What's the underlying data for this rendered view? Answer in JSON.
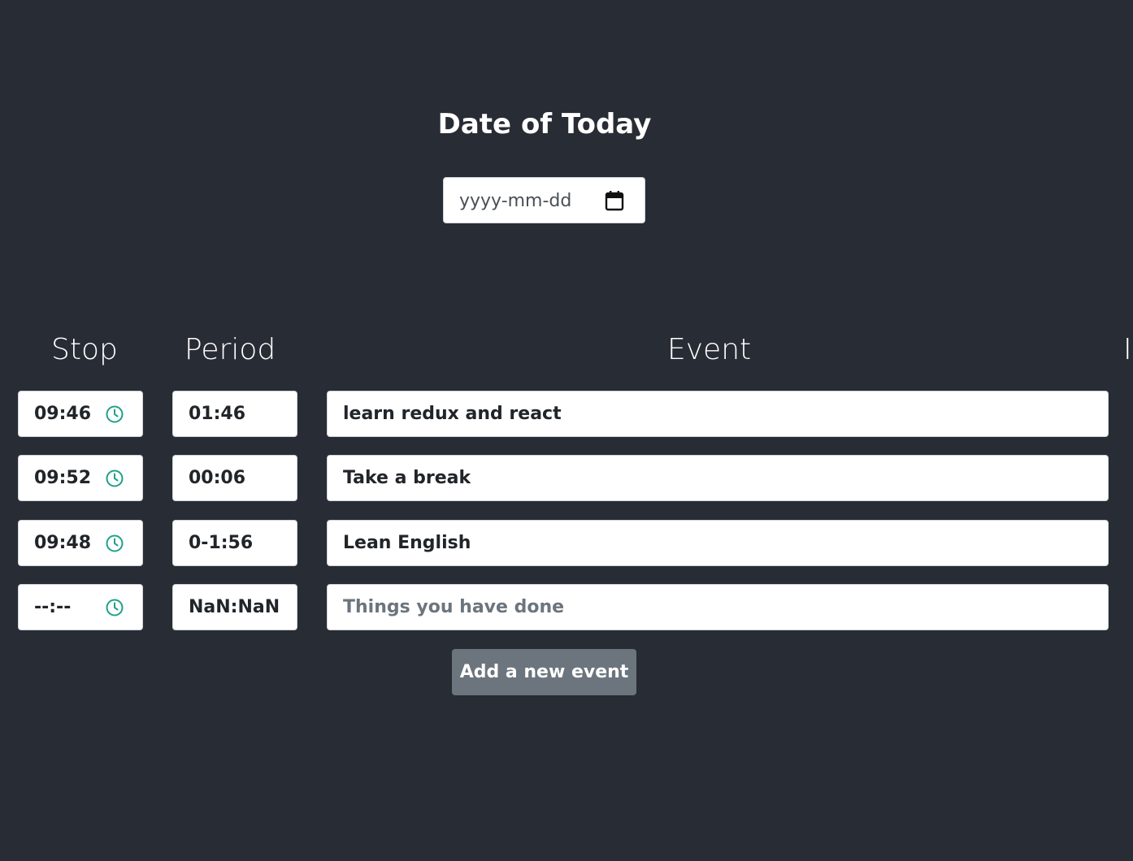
{
  "page": {
    "title": "Date of Today",
    "date_placeholder": "yyyy-mm-dd"
  },
  "columns": {
    "stop": "Stop",
    "period": "Period",
    "event": "Event",
    "partial_right": "I"
  },
  "rows": [
    {
      "stop": "09:46",
      "period": "01:46",
      "event": "learn redux and react",
      "event_is_placeholder": false
    },
    {
      "stop": "09:52",
      "period": "00:06",
      "event": "Take a break",
      "event_is_placeholder": false
    },
    {
      "stop": "09:48",
      "period": "0-1:56",
      "event": "Lean English",
      "event_is_placeholder": false
    },
    {
      "stop": "--:--",
      "period": "NaN:NaN",
      "event": "Things you have done",
      "event_is_placeholder": true
    }
  ],
  "actions": {
    "add_event_label": "Add a new event"
  },
  "colors": {
    "background": "#282c34",
    "clock_icon": "#20a08a",
    "button": "#6c757d"
  },
  "icons": {
    "date_picker": "calendar-icon",
    "time_picker": "clock-icon"
  }
}
